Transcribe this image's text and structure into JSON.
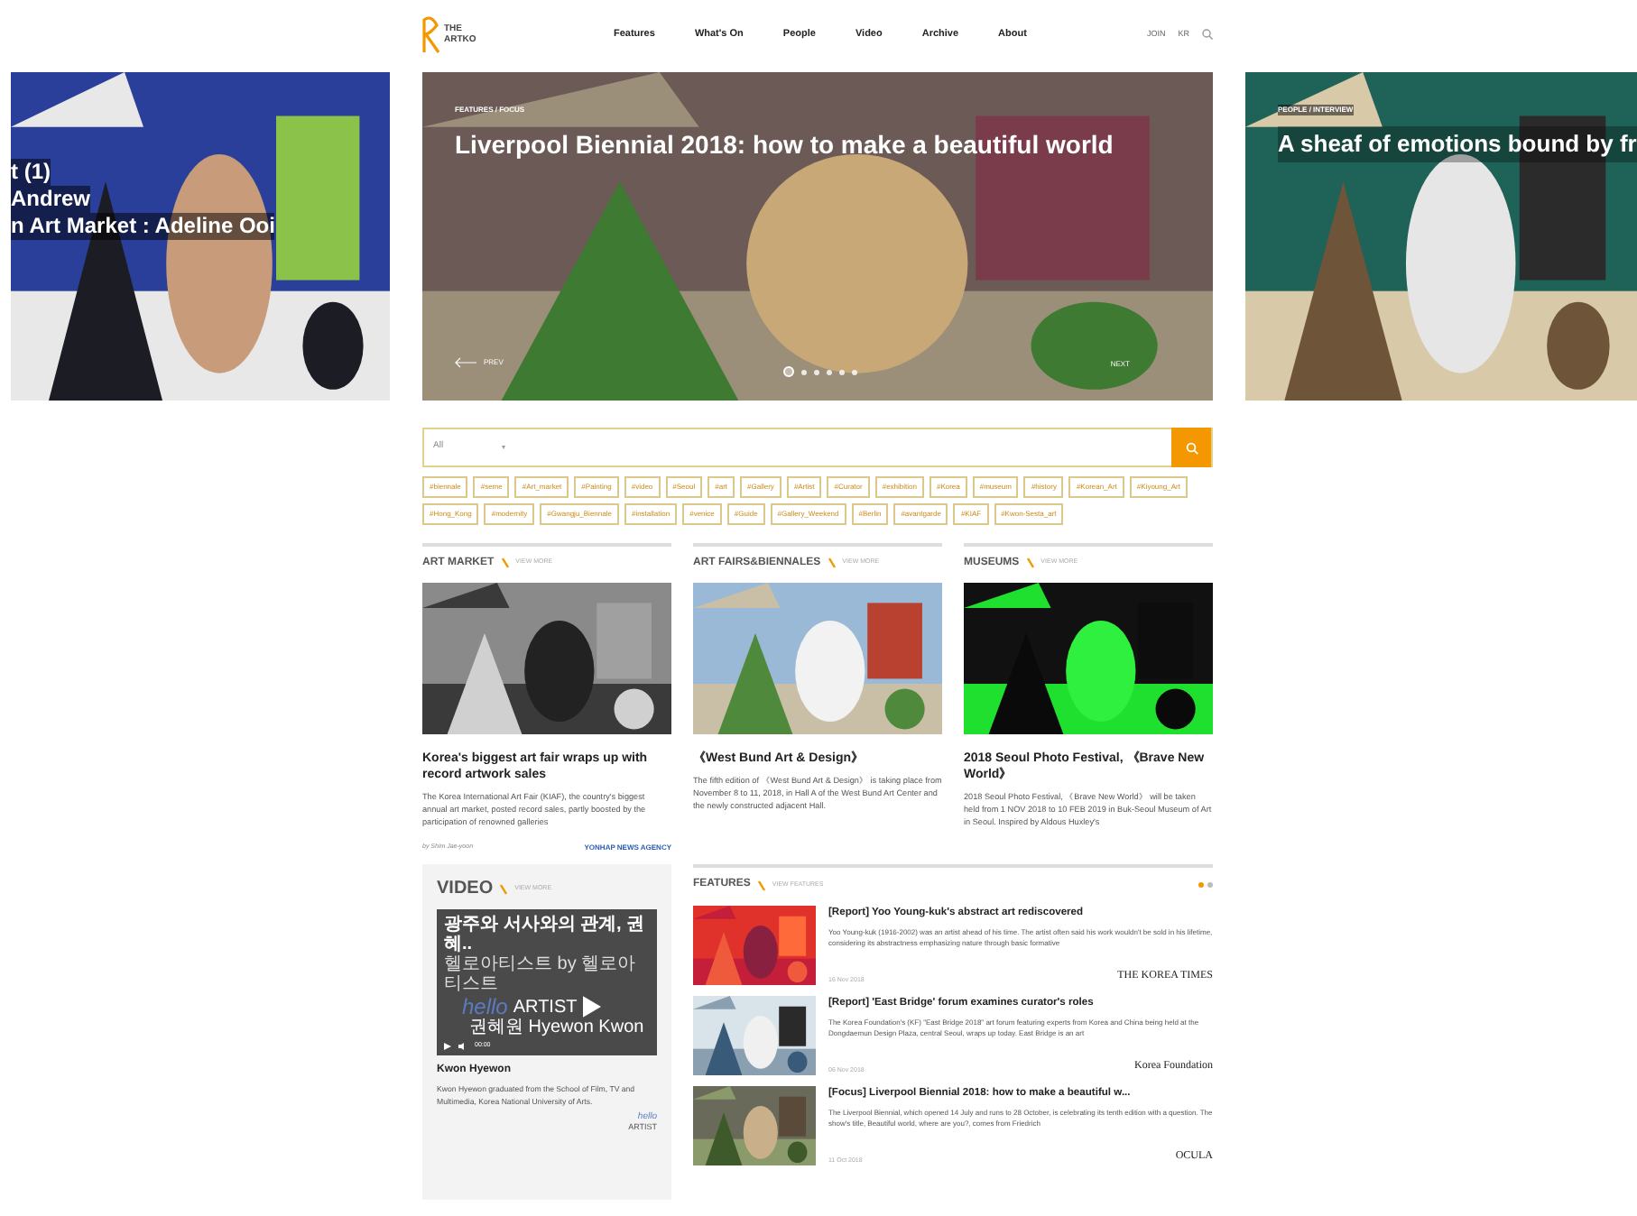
{
  "logo": {
    "line1": "THE",
    "line2": "ARTKO"
  },
  "nav": [
    {
      "label": "Features"
    },
    {
      "label": "What's On"
    },
    {
      "label": "People"
    },
    {
      "label": "Video"
    },
    {
      "label": "Archive"
    },
    {
      "label": "About"
    }
  ],
  "utility": [
    {
      "label": "JOIN"
    },
    {
      "label": "KR"
    }
  ],
  "left_slide": {
    "lines": [
      "t (1)",
      "Andrew",
      "n Art Market : Adeline Ooi"
    ]
  },
  "hero": {
    "category": "FEATURES / FOCUS",
    "title": "Liverpool Biennial 2018: how to make a beautiful world",
    "prev": "PREV",
    "next": "NEXT",
    "dots": [
      {
        "selected": true
      },
      {
        "selected": false
      },
      {
        "selected": false
      },
      {
        "selected": false
      },
      {
        "selected": false
      },
      {
        "selected": false
      }
    ]
  },
  "right_slide": {
    "category": "PEOPLE / INTERVIEW",
    "title": "A sheaf of emotions bound by fr"
  },
  "search": {
    "scope": "All"
  },
  "tags": [
    "#biennale",
    "#seme",
    "#Art_market",
    "#Painting",
    "#video",
    "#Seoul",
    "#art",
    "#Gallery",
    "#Artist",
    "#Curator",
    "#exhibition",
    "#Korea",
    "#museum",
    "#history",
    "#Korean_Art",
    "#Kiyoung_Art",
    "#Hong_Kong",
    "#modernity",
    "#Gwangju_Biennale",
    "#installation",
    "#venice",
    "#Guide",
    "#Gallery_Weekend",
    "#Berlin",
    "#avantgarde",
    "#KIAF",
    "#Kwon-Sesta_art"
  ],
  "sections": [
    {
      "title": "ART MARKET",
      "more": "VIEW MORE",
      "headline": "Korea's biggest art fair wraps up with record artwork sales",
      "summary": "The Korea International Art Fair (KIAF), the country's biggest annual art market, posted record sales, partly boosted by the participation of renowned galleries",
      "byline": "by Shim Jae-yoon",
      "source": "YONHAP NEWS AGENCY"
    },
    {
      "title": "ART FAIRS&BIENNALES",
      "more": "VIEW MORE",
      "headline": "《West Bund Art & Design》",
      "summary": "The fifth edition of 《West Bund Art & Design》 is taking place from November 8 to 11, 2018, in Hall A of the West Bund Art Center and the newly constructed adjacent Hall."
    },
    {
      "title": "MUSEUMS",
      "more": "VIEW MORE",
      "headline": "2018 Seoul Photo Festival, 《Brave New World》",
      "summary": "2018 Seoul Photo Festival, 《Brave New World》 will be taken held from 1 NOV 2018 to 10 FEB 2019 in Buk-Seoul Museum of Art in Seoul. Inspired by Aldous Huxley's"
    }
  ],
  "video": {
    "title": "VIDEO",
    "more": "VIEW MORE",
    "player": {
      "caption": "광주와 서사와의 관계, 권혜..",
      "channel": "헬로아티스트 by 헬로아티스트",
      "brand_a": "hello",
      "brand_b": "ARTIST",
      "subtitle": "권혜원 Hyewon Kwon",
      "time": "00:00"
    },
    "name": "Kwon Hyewon",
    "description": "Kwon Hyewon graduated from the School of Film, TV and Multimedia, Korea National University of Arts.",
    "logo_a": "hello",
    "logo_b": "ARTIST"
  },
  "features": {
    "title": "FEATURES",
    "more": "VIEW FEATURES",
    "pager": [
      {
        "selected": true
      },
      {
        "selected": false
      }
    ],
    "items": [
      {
        "title": "[Report] Yoo Young-kuk's abstract art rediscovered",
        "summary": "Yoo Young-kuk (1916-2002) was an artist ahead of his time. The artist often said his work wouldn't be sold in his lifetime, considering its abstractness emphasizing nature through basic formative",
        "date": "16 Nov 2018",
        "source": "THE KOREA TIMES"
      },
      {
        "title": "[Report] 'East Bridge' forum examines curator's roles",
        "summary": "The Korea Foundation's (KF) \"East Bridge 2018\" art forum featuring experts from Korea and China being held at the Dongdaemun Design Plaza, central Seoul, wraps up today. East Bridge is an art",
        "date": "06 Nov 2018",
        "source": "Korea Foundation"
      },
      {
        "title": "[Focus] Liverpool Biennial 2018: how to make a beautiful w...",
        "summary": "The Liverpool Biennial, which opened 14 July and runs to 28 October, is celebrating its tenth edition with a question. The show's title, Beautiful world, where are you?, comes from Friedrich",
        "date": "11 Oct 2018",
        "source": "OCULA"
      }
    ]
  }
}
